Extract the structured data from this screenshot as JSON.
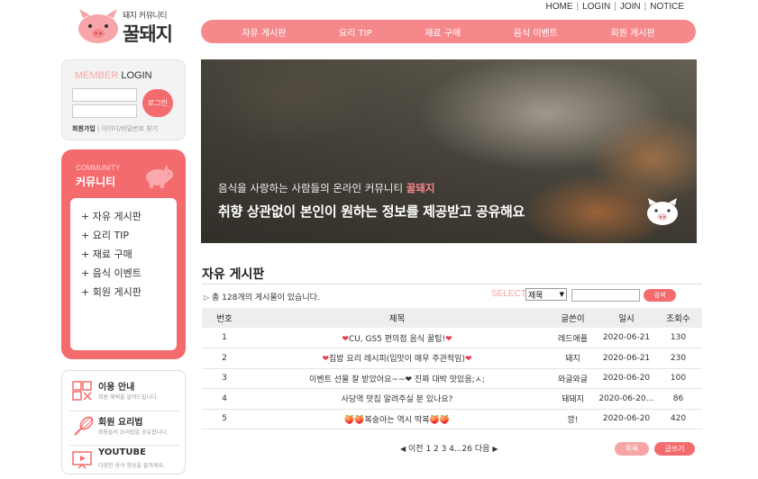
{
  "logo": {
    "sub": "돼지 커뮤니티",
    "name": "꿀돼지"
  },
  "util_nav": [
    "HOME",
    "LOGIN",
    "JOIN",
    "NOTICE"
  ],
  "gnb": [
    "자유 게시판",
    "요리 TIP",
    "재료 구매",
    "음식 이벤트",
    "회원 게시판"
  ],
  "login": {
    "title_member": "MEMBER",
    "title_login": "LOGIN",
    "button": "로그인",
    "join": "회원가입",
    "find": "아이디/비밀번호 찾기"
  },
  "community": {
    "en": "COMMUNITY",
    "ko": "커뮤니티",
    "items": [
      "+ 자유 게시판",
      "+ 요리 TIP",
      "+ 재료 구매",
      "+ 음식 이벤트",
      "+ 회원 게시판"
    ]
  },
  "info": [
    {
      "title": "이용 안내",
      "desc": "회원 혜택을 알려드립니다."
    },
    {
      "title": "회원 요리법",
      "desc": "회원들의 요리법을 공유합니다."
    },
    {
      "title": "YOUTUBE",
      "desc": "다양한 음식 영상을 즐겨세요."
    }
  ],
  "banner": {
    "line1": "음식을 사랑하는 사람들의 온라인 커뮤니티",
    "line1_highlight": "꿀돼지",
    "line2": "취향 상관없이 본인이 원하는 정보를 제공받고 공유해요"
  },
  "board": {
    "title": "자유 게시판",
    "count_text": "총 128개의 게시물이 있습니다.",
    "select_label": "SELECT",
    "select_value": "제목",
    "search_button": "검색",
    "headers": [
      "번호",
      "제목",
      "글쓴이",
      "일시",
      "조회수"
    ],
    "rows": [
      {
        "no": "1",
        "pre": "❤",
        "title": "CU, GS5 편의점 음식 꿀팁!",
        "post": "❤",
        "writer": "레드애플",
        "date": "2020-06-21",
        "views": "130",
        "kind": "heart"
      },
      {
        "no": "2",
        "pre": "❤",
        "title": "집밥 요리 레시피(입맛이 매우 주관적임)",
        "post": "❤",
        "writer": "돼지",
        "date": "2020-06-21",
        "views": "230",
        "kind": "heart"
      },
      {
        "no": "3",
        "pre": "",
        "title": "이벤트 선물 잘 받았어요~~",
        "post": "❤ 진짜 대박 맛있음;ㅅ;",
        "writer": "와글와글",
        "date": "2020-06-20",
        "views": "100",
        "kind": "heart"
      },
      {
        "no": "4",
        "pre": "",
        "title": "사당역 맛집 알려주실 분 있나요?",
        "post": "",
        "writer": "돼돼지",
        "date": "2020-06-20…",
        "views": "86",
        "kind": "none"
      },
      {
        "no": "5",
        "pre": "🍑🍑",
        "title": "복숭아는 역시 딱복",
        "post": "🍑🍑",
        "writer": "깡!",
        "date": "2020-06-20",
        "views": "420",
        "kind": "apple"
      }
    ],
    "pager": {
      "prev": "이전",
      "pages": "1 2 3 4...26",
      "next": "다음"
    },
    "list_button": "목록",
    "write_button": "글쓰기"
  },
  "colors": {
    "accent": "#f46b6e",
    "accent_light": "#f6888b",
    "pink_text": "#f6a5a7"
  }
}
